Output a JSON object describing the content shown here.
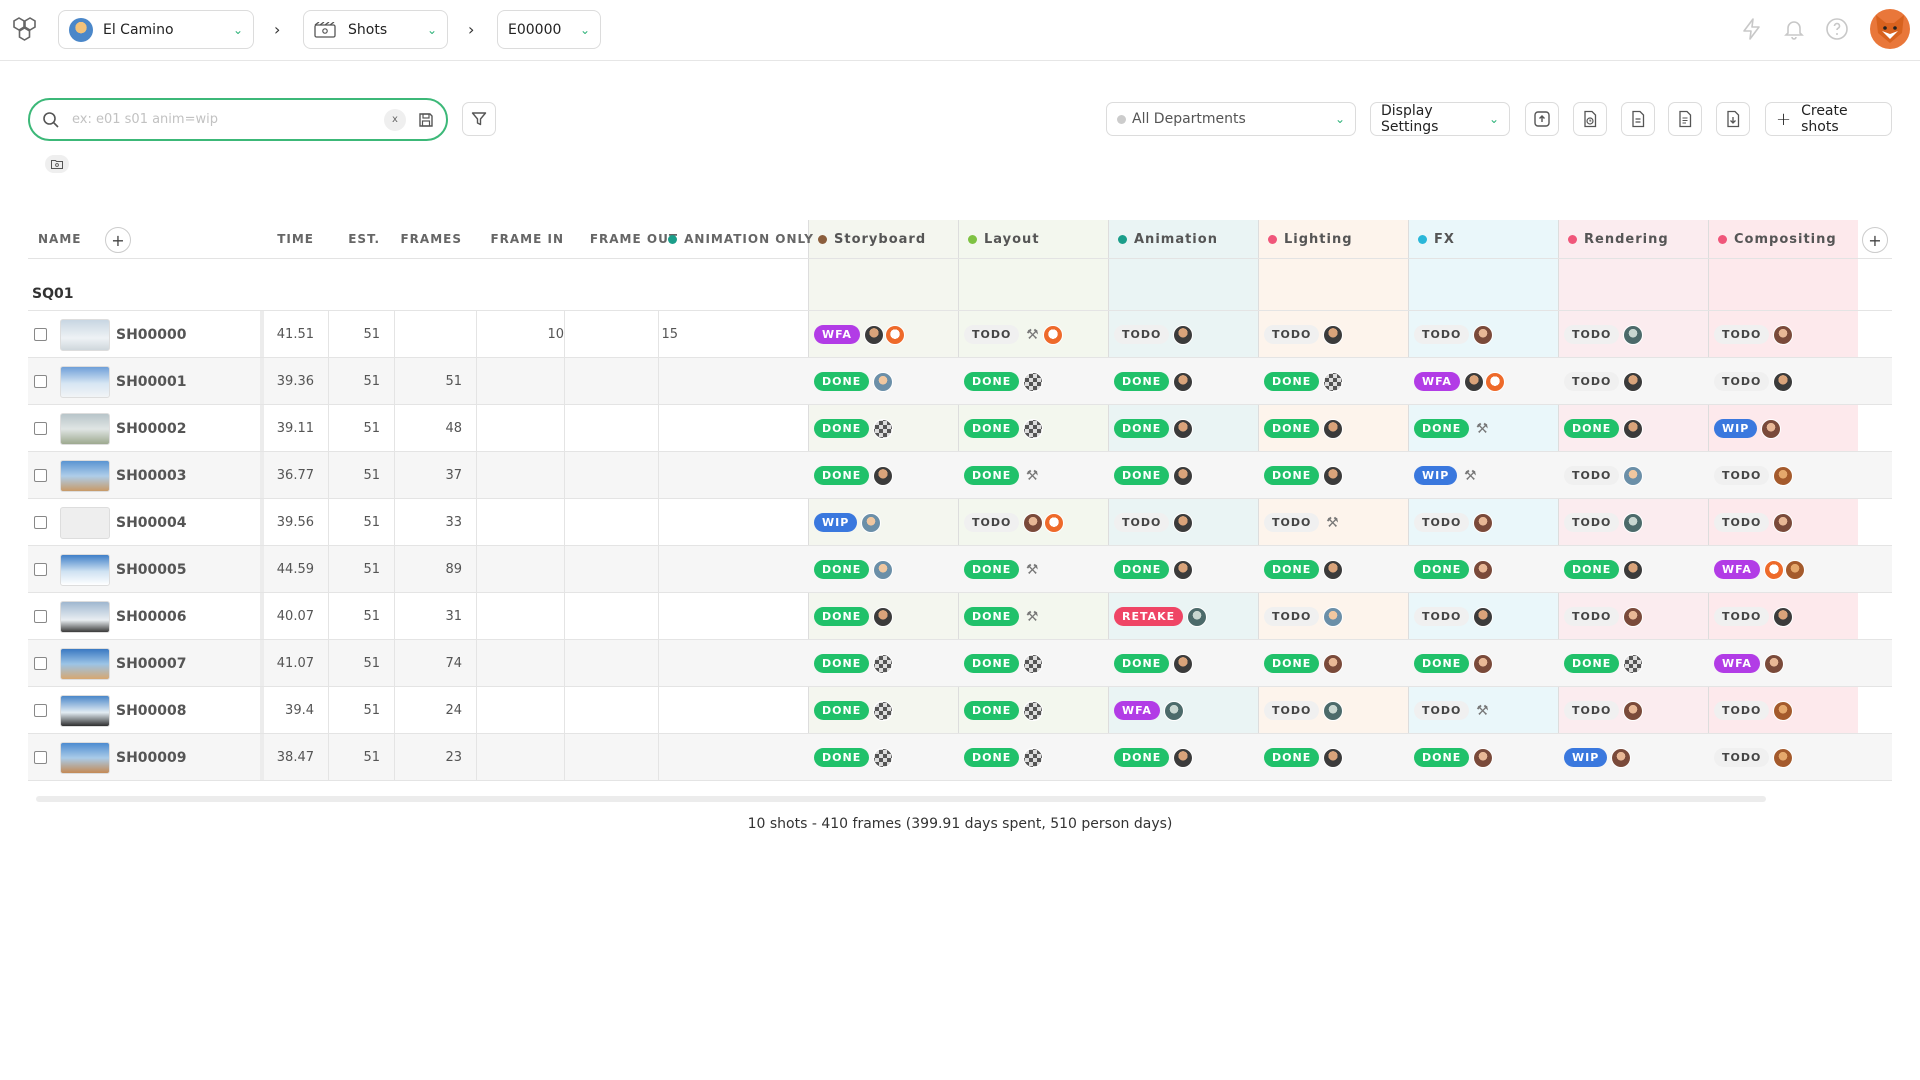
{
  "nav": {
    "project": "El Camino",
    "section": "Shots",
    "episode": "E00000"
  },
  "search": {
    "placeholder": "ex: e01 s01 anim=wip",
    "clear": "x"
  },
  "toolbar": {
    "department": "All Departments",
    "display_settings": "Display Settings",
    "create_shots": "Create shots"
  },
  "columns": {
    "name": "NAME",
    "time": "TIME",
    "est": "EST.",
    "frames": "FRAMES",
    "frame_in": "FRAME IN",
    "frame_out": "FRAME OUT",
    "animation_only": "ANIMATION ONLY"
  },
  "tasks": [
    {
      "name": "Storyboard",
      "color": "#8b5e3c",
      "tint": "#f4f6ef"
    },
    {
      "name": "Layout",
      "color": "#7ec242",
      "tint": "#f3f7ee"
    },
    {
      "name": "Animation",
      "color": "#1b9e8a",
      "tint": "#eaf4f4"
    },
    {
      "name": "Lighting",
      "color": "#f0567a",
      "tint": "#fdf4ec"
    },
    {
      "name": "FX",
      "color": "#2ab7d9",
      "tint": "#eaf7fa"
    },
    {
      "name": "Rendering",
      "color": "#f0567a",
      "tint": "#fbecef"
    },
    {
      "name": "Compositing",
      "color": "#f0567a",
      "tint": "#fde9ec"
    }
  ],
  "sequence": "SQ01",
  "shots": [
    {
      "name": "SH00000",
      "time": "41.51",
      "est": "51",
      "frames": "",
      "frame_in": "10",
      "frame_out": "15",
      "statuses": [
        [
          "WFA",
          [
            "a",
            "e"
          ]
        ],
        [
          "TODO",
          [
            "r",
            "e"
          ]
        ],
        [
          "TODO",
          [
            "a"
          ]
        ],
        [
          "TODO",
          [
            "a"
          ]
        ],
        [
          "TODO",
          [
            "b"
          ]
        ],
        [
          "TODO",
          [
            "h"
          ]
        ],
        [
          "TODO",
          [
            "b"
          ]
        ]
      ]
    },
    {
      "name": "SH00001",
      "time": "39.36",
      "est": "51",
      "frames": "51",
      "frame_in": "",
      "frame_out": "",
      "statuses": [
        [
          "DONE",
          [
            "f"
          ]
        ],
        [
          "DONE",
          [
            "c"
          ]
        ],
        [
          "DONE",
          [
            "a"
          ]
        ],
        [
          "DONE",
          [
            "c"
          ]
        ],
        [
          "WFA",
          [
            "a",
            "e"
          ]
        ],
        [
          "TODO",
          [
            "a"
          ]
        ],
        [
          "TODO",
          [
            "a"
          ]
        ]
      ]
    },
    {
      "name": "SH00002",
      "time": "39.11",
      "est": "51",
      "frames": "48",
      "frame_in": "",
      "frame_out": "",
      "statuses": [
        [
          "DONE",
          [
            "c"
          ]
        ],
        [
          "DONE",
          [
            "c"
          ]
        ],
        [
          "DONE",
          [
            "a"
          ]
        ],
        [
          "DONE",
          [
            "a"
          ]
        ],
        [
          "DONE",
          [
            "r"
          ]
        ],
        [
          "DONE",
          [
            "a"
          ]
        ],
        [
          "WIP",
          [
            "b"
          ]
        ]
      ]
    },
    {
      "name": "SH00003",
      "time": "36.77",
      "est": "51",
      "frames": "37",
      "frame_in": "",
      "frame_out": "",
      "statuses": [
        [
          "DONE",
          [
            "a"
          ]
        ],
        [
          "DONE",
          [
            "r"
          ]
        ],
        [
          "DONE",
          [
            "a"
          ]
        ],
        [
          "DONE",
          [
            "a"
          ]
        ],
        [
          "WIP",
          [
            "r"
          ]
        ],
        [
          "TODO",
          [
            "f"
          ]
        ],
        [
          "TODO",
          [
            "g"
          ]
        ]
      ]
    },
    {
      "name": "SH00004",
      "time": "39.56",
      "est": "51",
      "frames": "33",
      "frame_in": "",
      "frame_out": "",
      "statuses": [
        [
          "WIP",
          [
            "f"
          ]
        ],
        [
          "TODO",
          [
            "b",
            "e"
          ]
        ],
        [
          "TODO",
          [
            "a"
          ]
        ],
        [
          "TODO",
          [
            "r"
          ]
        ],
        [
          "TODO",
          [
            "b"
          ]
        ],
        [
          "TODO",
          [
            "h"
          ]
        ],
        [
          "TODO",
          [
            "b"
          ]
        ]
      ]
    },
    {
      "name": "SH00005",
      "time": "44.59",
      "est": "51",
      "frames": "89",
      "frame_in": "",
      "frame_out": "",
      "statuses": [
        [
          "DONE",
          [
            "f"
          ]
        ],
        [
          "DONE",
          [
            "r"
          ]
        ],
        [
          "DONE",
          [
            "a"
          ]
        ],
        [
          "DONE",
          [
            "a"
          ]
        ],
        [
          "DONE",
          [
            "b"
          ]
        ],
        [
          "DONE",
          [
            "a"
          ]
        ],
        [
          "WFA",
          [
            "e",
            "g"
          ]
        ]
      ]
    },
    {
      "name": "SH00006",
      "time": "40.07",
      "est": "51",
      "frames": "31",
      "frame_in": "",
      "frame_out": "",
      "statuses": [
        [
          "DONE",
          [
            "a"
          ]
        ],
        [
          "DONE",
          [
            "r"
          ]
        ],
        [
          "RETAKE",
          [
            "h"
          ]
        ],
        [
          "TODO",
          [
            "f"
          ]
        ],
        [
          "TODO",
          [
            "a"
          ]
        ],
        [
          "TODO",
          [
            "b"
          ]
        ],
        [
          "TODO",
          [
            "a"
          ]
        ]
      ]
    },
    {
      "name": "SH00007",
      "time": "41.07",
      "est": "51",
      "frames": "74",
      "frame_in": "",
      "frame_out": "",
      "statuses": [
        [
          "DONE",
          [
            "c"
          ]
        ],
        [
          "DONE",
          [
            "c"
          ]
        ],
        [
          "DONE",
          [
            "a"
          ]
        ],
        [
          "DONE",
          [
            "b"
          ]
        ],
        [
          "DONE",
          [
            "b"
          ]
        ],
        [
          "DONE",
          [
            "c"
          ]
        ],
        [
          "WFA",
          [
            "b"
          ]
        ]
      ]
    },
    {
      "name": "SH00008",
      "time": "39.4",
      "est": "51",
      "frames": "24",
      "frame_in": "",
      "frame_out": "",
      "statuses": [
        [
          "DONE",
          [
            "c"
          ]
        ],
        [
          "DONE",
          [
            "c"
          ]
        ],
        [
          "WFA",
          [
            "h"
          ]
        ],
        [
          "TODO",
          [
            "h"
          ]
        ],
        [
          "TODO",
          [
            "r"
          ]
        ],
        [
          "TODO",
          [
            "b"
          ]
        ],
        [
          "TODO",
          [
            "g"
          ]
        ]
      ]
    },
    {
      "name": "SH00009",
      "time": "38.47",
      "est": "51",
      "frames": "23",
      "frame_in": "",
      "frame_out": "",
      "statuses": [
        [
          "DONE",
          [
            "c"
          ]
        ],
        [
          "DONE",
          [
            "c"
          ]
        ],
        [
          "DONE",
          [
            "a"
          ]
        ],
        [
          "DONE",
          [
            "a"
          ]
        ],
        [
          "DONE",
          [
            "b"
          ]
        ],
        [
          "WIP",
          [
            "b"
          ]
        ],
        [
          "TODO",
          [
            "g"
          ]
        ]
      ]
    }
  ],
  "summary": "10 shots - 410 frames (399.91 days spent, 510 person days)"
}
